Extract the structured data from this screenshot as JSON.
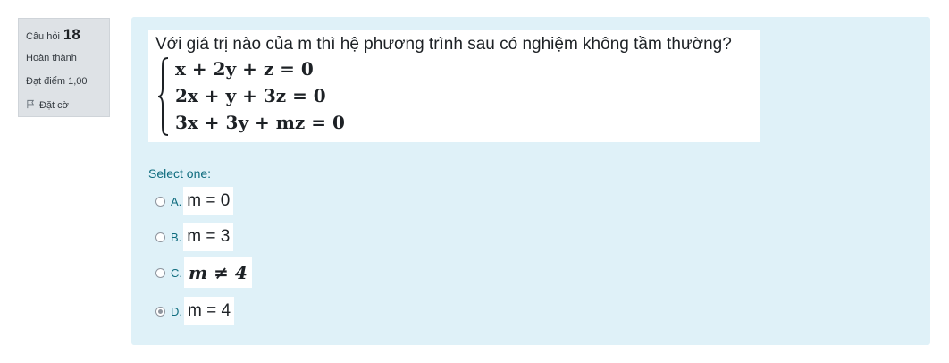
{
  "info": {
    "question_prefix": "Câu hỏi",
    "question_number": "18",
    "state": "Hoàn thành",
    "grade": "Đạt điểm 1,00",
    "flag_label": "Đặt cờ",
    "flag_icon": "flag-icon"
  },
  "question": {
    "text": "Với giá trị nào của m thì hệ phương trình sau có nghiệm không tầm thường?",
    "equations": [
      "x + 2y + z = 0",
      "2x + y + 3z = 0",
      "3x + 3y + mz = 0"
    ]
  },
  "answers": {
    "prompt": "Select one:",
    "options": [
      {
        "letter": "A.",
        "text": "m = 0",
        "checked": false
      },
      {
        "letter": "B.",
        "text": "m = 3",
        "checked": false
      },
      {
        "letter": "C.",
        "text": "m ≠ 4",
        "checked": false
      },
      {
        "letter": "D.",
        "text": "m = 4",
        "checked": true
      }
    ]
  },
  "colors": {
    "content_bg": "#dff1f8",
    "info_bg": "#dee2e6",
    "accent_text": "#0f6c7e"
  }
}
